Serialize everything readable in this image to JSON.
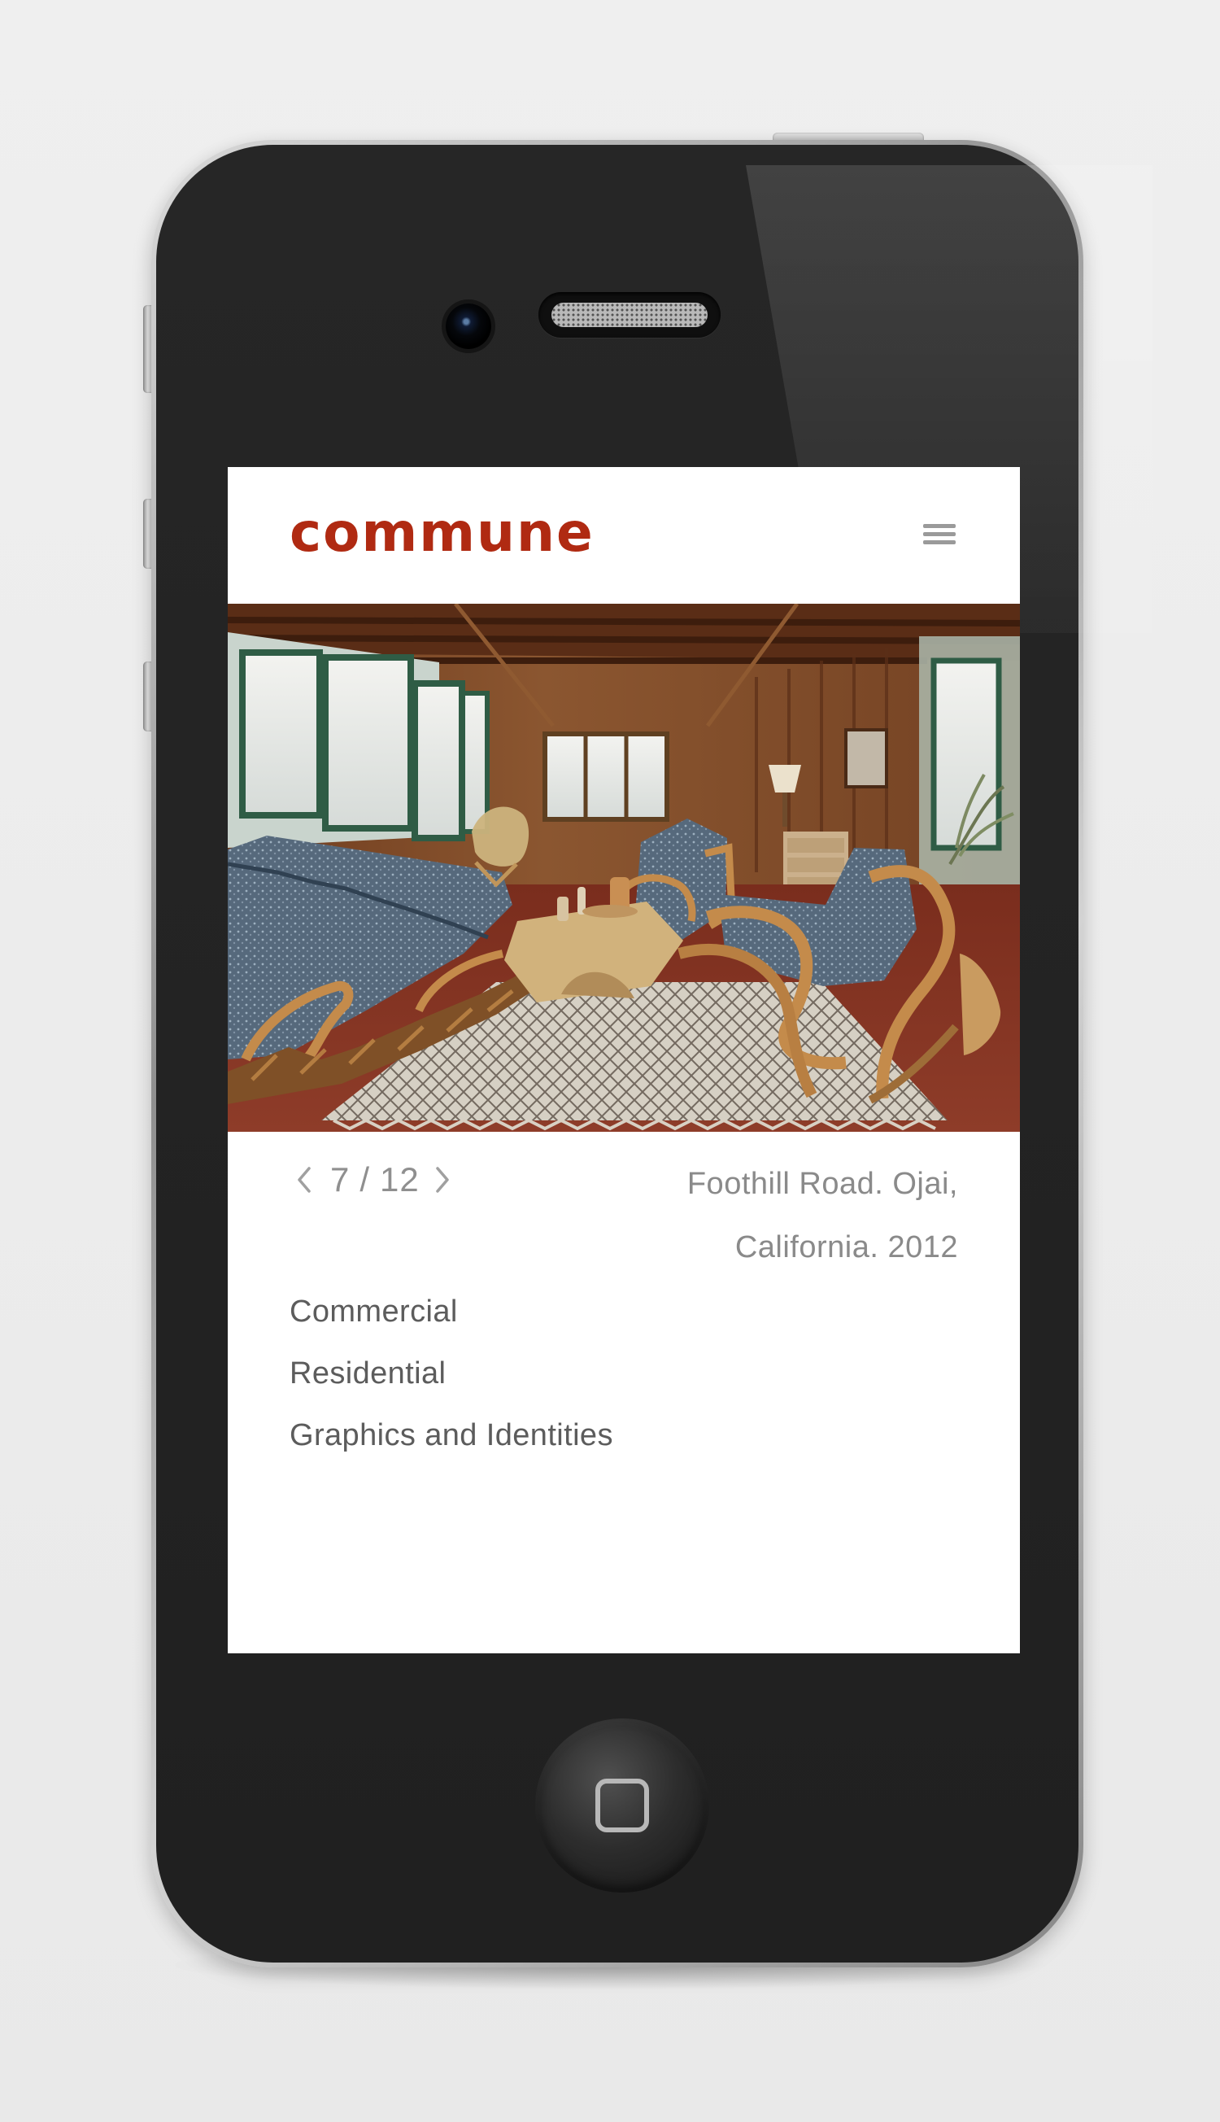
{
  "brand": {
    "name": "commune",
    "color": "#b02a12"
  },
  "header": {
    "menu_icon": "hamburger-menu-icon"
  },
  "hero": {
    "subject": "interior-living-room-photo"
  },
  "gallery": {
    "current": "7",
    "separator": "/",
    "total": "12",
    "prev_icon": "chevron-left-icon",
    "next_icon": "chevron-right-icon"
  },
  "caption": {
    "line1": "Foothill Road. Ojai,",
    "line2": "California. 2012"
  },
  "categories": {
    "items": [
      {
        "label": "Commercial"
      },
      {
        "label": "Residential"
      },
      {
        "label": "Graphics and Identities"
      }
    ]
  },
  "device": {
    "home_icon": "home-button-icon"
  }
}
